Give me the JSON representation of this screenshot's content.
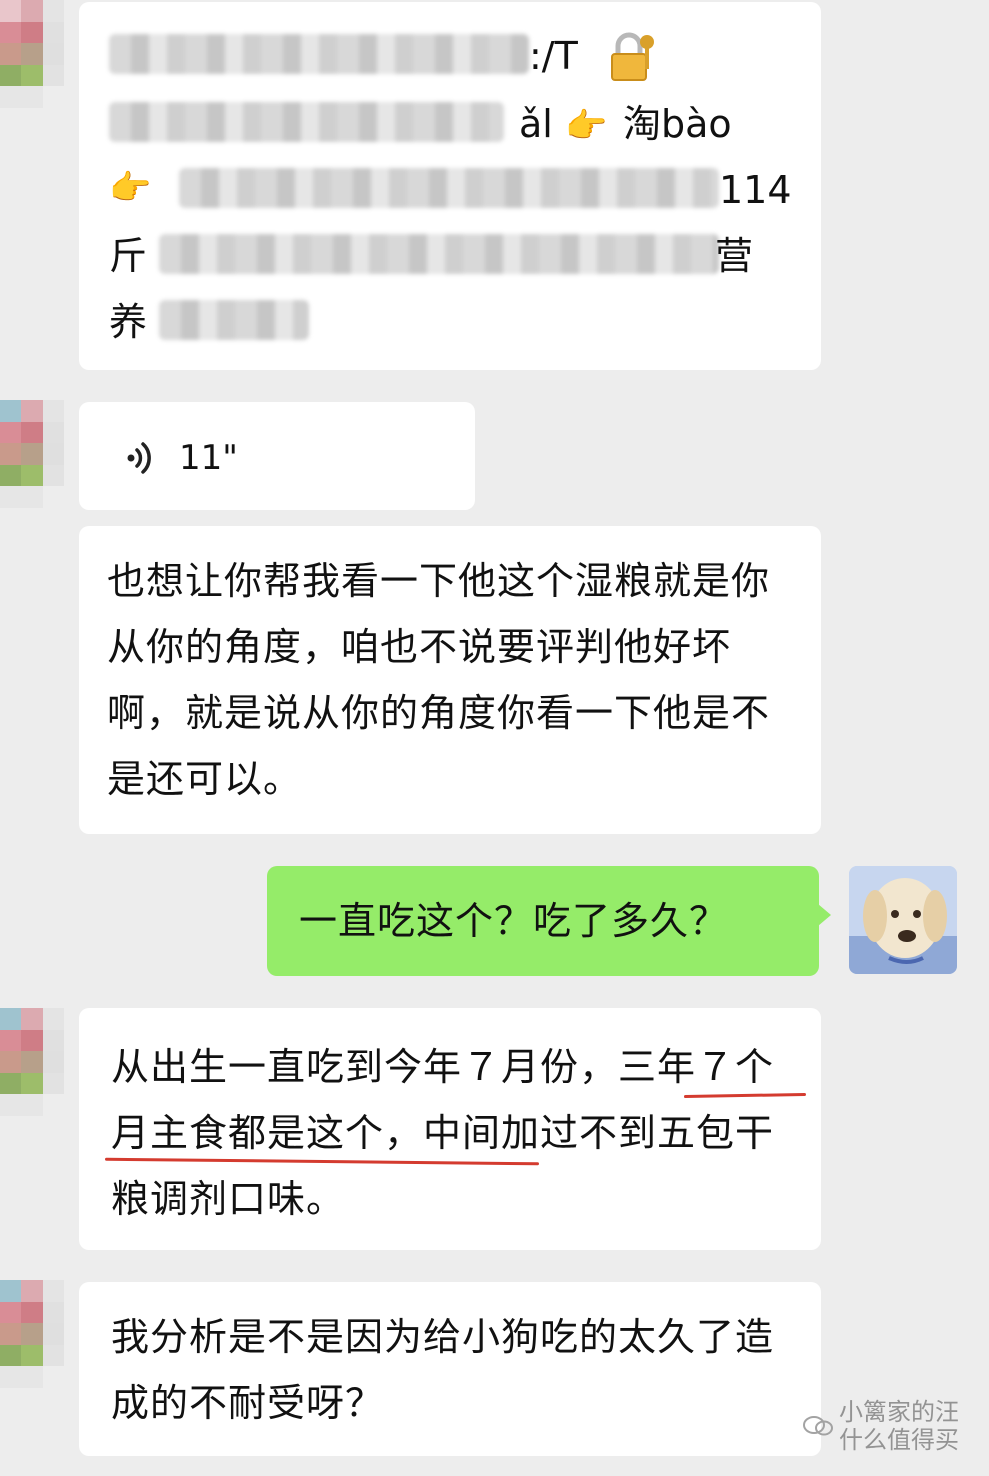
{
  "chat": {
    "messages": [
      {
        "sender": "other",
        "type": "shared_link",
        "visible_fragments": {
          "line1": ":/T",
          "line2": "ǎl",
          "line2_tail": "淘bào",
          "line3": "114",
          "line4": "斤",
          "line4_end": "营",
          "line5": "养"
        }
      },
      {
        "sender": "other",
        "type": "voice",
        "duration": "11\""
      },
      {
        "sender": "other",
        "type": "text",
        "text": "也想让你帮我看一下他这个湿粮就是你从你的角度，咱也不说要评判他好坏啊，就是说从你的角度你看一下他是不是还可以。"
      },
      {
        "sender": "self",
        "type": "text",
        "text": "一直吃这个？吃了多久？"
      },
      {
        "sender": "other",
        "type": "text",
        "text": "从出生一直吃到今年７月份，三年７个月主食都是这个，中间加过不到五包干粮调剂口味。"
      },
      {
        "sender": "other",
        "type": "text",
        "text": "我分析是不是因为给小狗吃的太久了造成的不耐受呀？"
      }
    ]
  },
  "watermark": {
    "line1": "小篱家的汪",
    "line2": "什么值得买"
  },
  "colors": {
    "background": "#ededed",
    "incoming_bubble": "#ffffff",
    "outgoing_bubble": "#95ec69",
    "annotation_underline": "#d43b2f"
  },
  "icons": [
    "voice-icon",
    "lock-icon",
    "pointing-hand-icon",
    "watermark-logo-icon"
  ]
}
